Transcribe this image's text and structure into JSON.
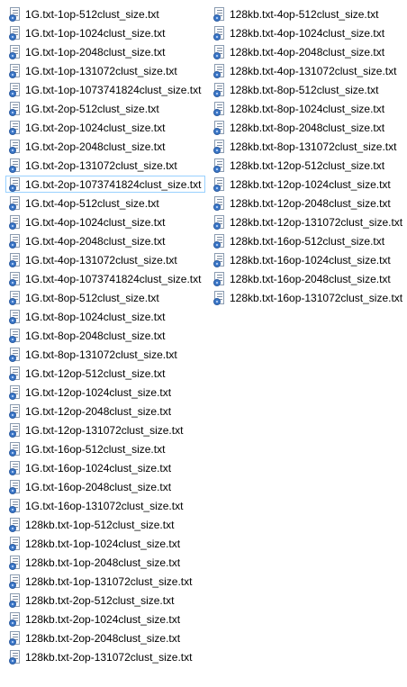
{
  "focused_index": 9,
  "icon": "config-file-icon",
  "files": [
    "1G.txt-1op-512clust_size.txt",
    "1G.txt-1op-1024clust_size.txt",
    "1G.txt-1op-2048clust_size.txt",
    "1G.txt-1op-131072clust_size.txt",
    "1G.txt-1op-1073741824clust_size.txt",
    "1G.txt-2op-512clust_size.txt",
    "1G.txt-2op-1024clust_size.txt",
    "1G.txt-2op-2048clust_size.txt",
    "1G.txt-2op-131072clust_size.txt",
    "1G.txt-2op-1073741824clust_size.txt",
    "1G.txt-4op-512clust_size.txt",
    "1G.txt-4op-1024clust_size.txt",
    "1G.txt-4op-2048clust_size.txt",
    "1G.txt-4op-131072clust_size.txt",
    "1G.txt-4op-1073741824clust_size.txt",
    "1G.txt-8op-512clust_size.txt",
    "1G.txt-8op-1024clust_size.txt",
    "1G.txt-8op-2048clust_size.txt",
    "1G.txt-8op-131072clust_size.txt",
    "1G.txt-12op-512clust_size.txt",
    "1G.txt-12op-1024clust_size.txt",
    "1G.txt-12op-2048clust_size.txt",
    "1G.txt-12op-131072clust_size.txt",
    "1G.txt-16op-512clust_size.txt",
    "1G.txt-16op-1024clust_size.txt",
    "1G.txt-16op-2048clust_size.txt",
    "1G.txt-16op-131072clust_size.txt",
    "128kb.txt-1op-512clust_size.txt",
    "128kb.txt-1op-1024clust_size.txt",
    "128kb.txt-1op-2048clust_size.txt",
    "128kb.txt-1op-131072clust_size.txt",
    "128kb.txt-2op-512clust_size.txt",
    "128kb.txt-2op-1024clust_size.txt",
    "128kb.txt-2op-2048clust_size.txt",
    "128kb.txt-2op-131072clust_size.txt",
    "128kb.txt-4op-512clust_size.txt",
    "128kb.txt-4op-1024clust_size.txt",
    "128kb.txt-4op-2048clust_size.txt",
    "128kb.txt-4op-131072clust_size.txt",
    "128kb.txt-8op-512clust_size.txt",
    "128kb.txt-8op-1024clust_size.txt",
    "128kb.txt-8op-2048clust_size.txt",
    "128kb.txt-8op-131072clust_size.txt",
    "128kb.txt-12op-512clust_size.txt",
    "128kb.txt-12op-1024clust_size.txt",
    "128kb.txt-12op-2048clust_size.txt",
    "128kb.txt-12op-131072clust_size.txt",
    "128kb.txt-16op-512clust_size.txt",
    "128kb.txt-16op-1024clust_size.txt",
    "128kb.txt-16op-2048clust_size.txt",
    "128kb.txt-16op-131072clust_size.txt"
  ]
}
